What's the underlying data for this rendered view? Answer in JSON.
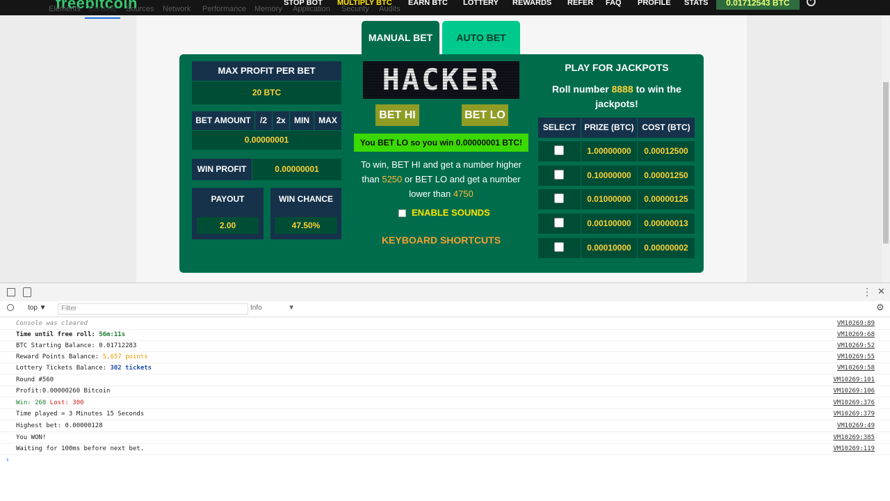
{
  "site": {
    "logo": "freebitcoin",
    "nav": [
      "STOP BOT",
      "MULTIPLY BTC",
      "EARN BTC",
      "LOTTERY",
      "REWARDS",
      "REFER",
      "FAQ",
      "PROFILE",
      "STATS"
    ],
    "active_nav": "MULTIPLY BTC",
    "balance": "0.01712543 BTC"
  },
  "tabs": {
    "manual": "MANUAL BET",
    "auto": "AUTO BET"
  },
  "left": {
    "max_profit_label": "MAX PROFIT PER BET",
    "max_profit_value": "20 BTC",
    "bet_amount_label": "BET AMOUNT",
    "bet_controls": [
      "/2",
      "2x",
      "MIN",
      "MAX"
    ],
    "bet_amount_value": "0.00000001",
    "win_profit_label": "WIN PROFIT",
    "win_profit_value": "0.00000001",
    "payout_label": "PAYOUT",
    "payout_value": "2.00",
    "win_chance_label": "WIN CHANCE",
    "win_chance_value": "47.50%"
  },
  "center": {
    "hacker_text": "HACKER",
    "bet_hi": "BET HI",
    "bet_lo": "BET LO",
    "result": "You BET LO so you win 0.00000001 BTC!",
    "info_1": "To win, BET HI and get a number higher than",
    "hi_number": "5250",
    "info_2": "or BET LO and get a number lower than",
    "lo_number": "4750",
    "enable_sounds": "ENABLE SOUNDS",
    "keyboard_shortcuts": "KEYBOARD SHORTCUTS"
  },
  "jackpot": {
    "title": "PLAY FOR JACKPOTS",
    "sub_1": "Roll number",
    "sub_number": "8888",
    "sub_2": "to win the jackpots!",
    "headers": [
      "SELECT",
      "PRIZE (BTC)",
      "COST (BTC)"
    ],
    "rows": [
      {
        "prize": "1.00000000",
        "cost": "0.00012500"
      },
      {
        "prize": "0.10000000",
        "cost": "0.00001250"
      },
      {
        "prize": "0.01000000",
        "cost": "0.00000125"
      },
      {
        "prize": "0.00100000",
        "cost": "0.00000013"
      },
      {
        "prize": "0.00010000",
        "cost": "0.00000002"
      }
    ]
  },
  "devtools": {
    "tabs": [
      "Elements",
      "Console",
      "Sources",
      "Network",
      "Performance",
      "Memory",
      "Application",
      "Security",
      "Audits"
    ],
    "active_tab": "Console",
    "context": "top",
    "filter_placeholder": "Filter",
    "level": "Info",
    "logs": [
      {
        "text": "Console was cleared",
        "link": "VM10269:89"
      },
      {
        "text": "Time until free roll: ",
        "value": "56m:11s",
        "link": "VM10269:68"
      },
      {
        "text": "BTC Starting Balance: 0.01712283",
        "link": "VM10269:52"
      },
      {
        "text": "Reward Points Balance: ",
        "value": "5,657 points",
        "link": "VM10269:55"
      },
      {
        "text": "Lottery Tickets Balance: ",
        "value": "302 tickets",
        "link": "VM10269:58"
      },
      {
        "text": "Round #560",
        "link": "VM10269:101"
      },
      {
        "text": "Profit:0.00000260 Bitcoin",
        "link": "VM10269:106"
      },
      {
        "text": "Win: 260",
        "text2": "Lost: 300",
        "link": "VM10269:376"
      },
      {
        "text": "Time played = 3 Minutes 15 Seconds",
        "link": "VM10269:379"
      },
      {
        "text": "Highest bet: 0.00000128",
        "link": "VM10269:49"
      },
      {
        "text": "You WON!",
        "link": "VM10269:385"
      },
      {
        "text": "Waiting for 100ms before next bet.",
        "link": "VM10269:119"
      }
    ]
  }
}
